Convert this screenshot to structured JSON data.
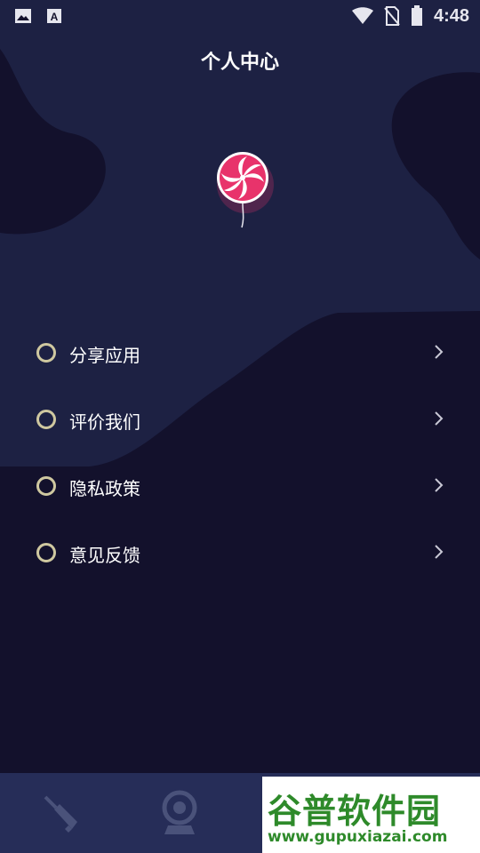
{
  "statusbar": {
    "time": "4:48"
  },
  "page": {
    "title": "个人中心"
  },
  "menu": {
    "items": [
      {
        "label": "分享应用"
      },
      {
        "label": "评价我们"
      },
      {
        "label": "隐私政策"
      },
      {
        "label": "意见反馈"
      }
    ]
  },
  "bottom_nav": {
    "tabs": [
      {
        "icon": "broom-icon"
      },
      {
        "icon": "camera-icon"
      }
    ]
  },
  "watermark": {
    "title": "谷普软件园",
    "url": "www.gupuxiazai.com"
  },
  "colors": {
    "background": "#13112c",
    "blob": "#1d2143",
    "accent_ring": "#cfc8a0",
    "bottom_bar": "#262d58",
    "lollipop": "#e8336b"
  }
}
